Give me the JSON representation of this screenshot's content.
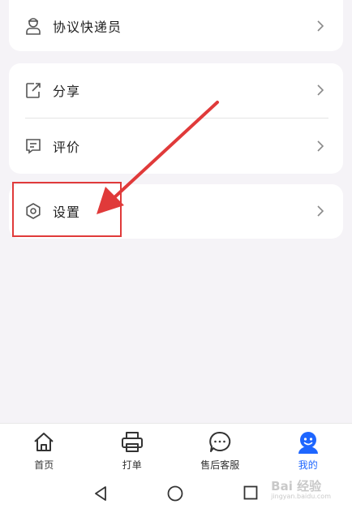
{
  "menu": {
    "courier": {
      "label": "协议快递员",
      "icon": "courier-person-icon"
    },
    "share": {
      "label": "分享",
      "icon": "share-icon"
    },
    "review": {
      "label": "评价",
      "icon": "comment-icon"
    },
    "settings": {
      "label": "设置",
      "icon": "gear-icon"
    }
  },
  "annotation": {
    "color": "#e03a3a"
  },
  "tabbar": {
    "tabs": [
      {
        "label": "首页",
        "icon": "home-icon",
        "active": false
      },
      {
        "label": "打单",
        "icon": "printer-icon",
        "active": false
      },
      {
        "label": "售后客服",
        "icon": "chat-icon",
        "active": false
      },
      {
        "label": "我的",
        "icon": "profile-avatar-icon",
        "active": true
      }
    ],
    "active_color": "#1e66ff"
  },
  "system_nav": [
    "back-icon",
    "home-circle-icon",
    "recents-icon"
  ],
  "watermark": {
    "text": "Bai 经验",
    "sub": "jingyan.baidu.com"
  }
}
